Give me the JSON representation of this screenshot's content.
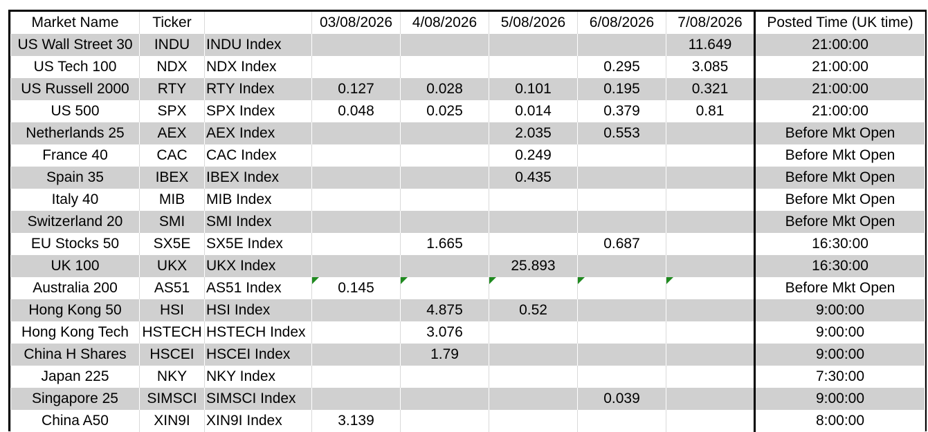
{
  "headers": {
    "market_name": "Market Name",
    "ticker": "Ticker",
    "bbg": "",
    "d1": "03/08/2026",
    "d2": "4/08/2026",
    "d3": "5/08/2026",
    "d4": "6/08/2026",
    "d5": "7/08/2026",
    "posted": "Posted Time (UK time)"
  },
  "rows": [
    {
      "name": "US Wall Street 30",
      "ticker": "INDU",
      "bbg": "INDU  Index",
      "d1": "",
      "d2": "",
      "d3": "",
      "d4": "",
      "d5": "11.649",
      "posted": "21:00:00"
    },
    {
      "name": "US Tech 100",
      "ticker": "NDX",
      "bbg": "NDX Index",
      "d1": "",
      "d2": "",
      "d3": "",
      "d4": "0.295",
      "d5": "3.085",
      "posted": "21:00:00"
    },
    {
      "name": "US Russell 2000",
      "ticker": "RTY",
      "bbg": "RTY Index",
      "d1": "0.127",
      "d2": "0.028",
      "d3": "0.101",
      "d4": "0.195",
      "d5": "0.321",
      "posted": "21:00:00"
    },
    {
      "name": "US 500",
      "ticker": "SPX",
      "bbg": "SPX Index",
      "d1": "0.048",
      "d2": "0.025",
      "d3": "0.014",
      "d4": "0.379",
      "d5": "0.81",
      "posted": "21:00:00"
    },
    {
      "name": "Netherlands 25",
      "ticker": "AEX",
      "bbg": "AEX Index",
      "d1": "",
      "d2": "",
      "d3": "2.035",
      "d4": "0.553",
      "d5": "",
      "posted": "Before Mkt Open"
    },
    {
      "name": "France 40",
      "ticker": "CAC",
      "bbg": "CAC Index",
      "d1": "",
      "d2": "",
      "d3": "0.249",
      "d4": "",
      "d5": "",
      "posted": "Before Mkt Open"
    },
    {
      "name": "Spain 35",
      "ticker": "IBEX",
      "bbg": "IBEX Index",
      "d1": "",
      "d2": "",
      "d3": "0.435",
      "d4": "",
      "d5": "",
      "posted": "Before Mkt Open"
    },
    {
      "name": "Italy 40",
      "ticker": "MIB",
      "bbg": "MIB Index",
      "d1": "",
      "d2": "",
      "d3": "",
      "d4": "",
      "d5": "",
      "posted": "Before Mkt Open"
    },
    {
      "name": "Switzerland 20",
      "ticker": "SMI",
      "bbg": "SMI Index",
      "d1": "",
      "d2": "",
      "d3": "",
      "d4": "",
      "d5": "",
      "posted": "Before Mkt Open"
    },
    {
      "name": "EU Stocks 50",
      "ticker": "SX5E",
      "bbg": "SX5E Index",
      "d1": "",
      "d2": "1.665",
      "d3": "",
      "d4": "0.687",
      "d5": "",
      "posted": "16:30:00"
    },
    {
      "name": "UK 100",
      "ticker": "UKX",
      "bbg": "UKX Index",
      "d1": "",
      "d2": "",
      "d3": "25.893",
      "d4": "",
      "d5": "",
      "posted": "16:30:00"
    },
    {
      "name": "Australia 200",
      "ticker": "AS51",
      "bbg": "AS51 Index",
      "d1": "0.145",
      "d2": "",
      "d3": "",
      "d4": "",
      "d5": "",
      "posted": "Before Mkt Open"
    },
    {
      "name": "Hong Kong 50",
      "ticker": "HSI",
      "bbg": "HSI Index",
      "d1": "",
      "d2": "4.875",
      "d3": "0.52",
      "d4": "",
      "d5": "",
      "posted": "9:00:00"
    },
    {
      "name": "Hong Kong Tech",
      "ticker": "HSTECH",
      "bbg": "HSTECH Index",
      "d1": "",
      "d2": "3.076",
      "d3": "",
      "d4": "",
      "d5": "",
      "posted": "9:00:00"
    },
    {
      "name": "China H Shares",
      "ticker": "HSCEI",
      "bbg": "HSCEI Index",
      "d1": "",
      "d2": "1.79",
      "d3": "",
      "d4": "",
      "d5": "",
      "posted": "9:00:00"
    },
    {
      "name": "Japan 225",
      "ticker": "NKY",
      "bbg": "NKY Index",
      "d1": "",
      "d2": "",
      "d3": "",
      "d4": "",
      "d5": "",
      "posted": "7:30:00"
    },
    {
      "name": "Singapore 25",
      "ticker": "SIMSCI",
      "bbg": "SIMSCI Index",
      "d1": "",
      "d2": "",
      "d3": "",
      "d4": "0.039",
      "d5": "",
      "posted": "9:00:00"
    },
    {
      "name": "China A50",
      "ticker": "XIN9I",
      "bbg": "XIN9I Index",
      "d1": "3.139",
      "d2": "",
      "d3": "",
      "d4": "",
      "d5": "",
      "posted": "8:00:00"
    }
  ],
  "row_shading": [
    "grey",
    "white",
    "grey",
    "white",
    "grey",
    "white",
    "grey",
    "white",
    "grey",
    "white",
    "grey",
    "white",
    "grey",
    "white",
    "grey",
    "white",
    "grey",
    "white"
  ],
  "comment_indicator_row": 11,
  "colors": {
    "grey_row": "#d0d0d0",
    "white_row": "#ffffff",
    "comment_marker": "#1f8a1f",
    "border": "#000000"
  }
}
